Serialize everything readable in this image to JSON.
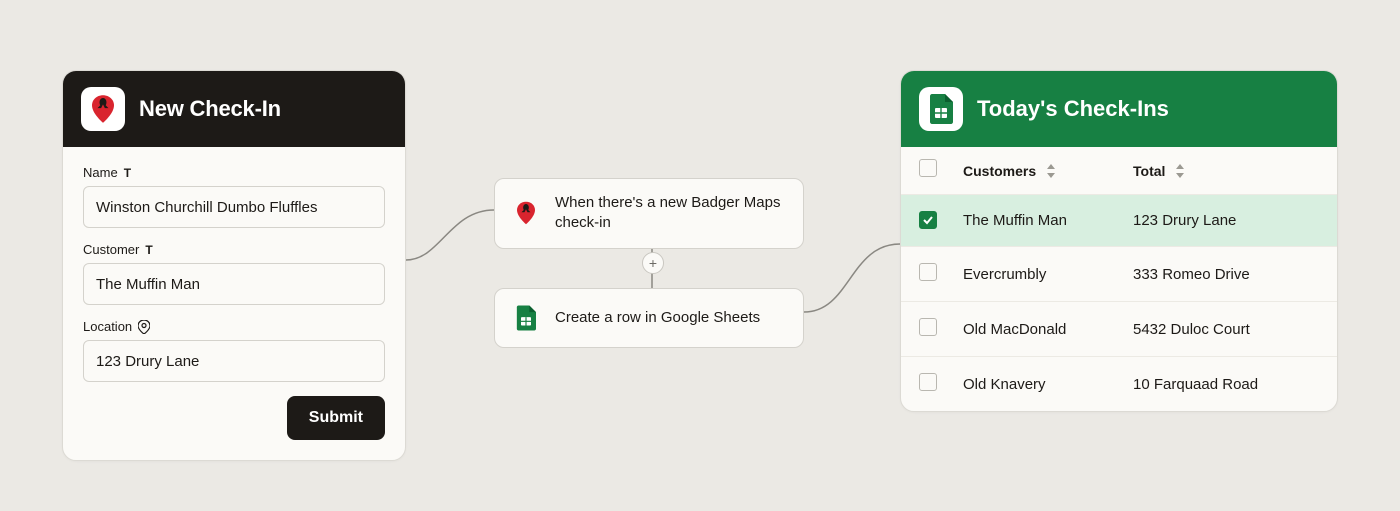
{
  "colors": {
    "brand_dark": "#1d1a17",
    "sheets_green": "#178043",
    "selected_row": "#d8efe0"
  },
  "form": {
    "title": "New Check-In",
    "fields": {
      "name": {
        "label": "Name",
        "type_glyph": "T",
        "value": "Winston Churchill Dumbo Fluffles"
      },
      "customer": {
        "label": "Customer",
        "type_glyph": "T",
        "value": "The Muffin Man"
      },
      "location": {
        "label": "Location",
        "type_glyph": "pin",
        "value": "123 Drury Lane"
      }
    },
    "submit_label": "Submit"
  },
  "steps": {
    "trigger": "When there's a new Badger Maps check-in",
    "action": "Create a row in Google Sheets",
    "add_glyph": "+"
  },
  "sheet": {
    "title": "Today's Check-Ins",
    "columns": {
      "col1": "Customers",
      "col2": "Total"
    },
    "rows": [
      {
        "checked": true,
        "customer": "The Muffin Man",
        "total": "123 Drury Lane"
      },
      {
        "checked": false,
        "customer": "Evercrumbly",
        "total": "333 Romeo Drive"
      },
      {
        "checked": false,
        "customer": "Old MacDonald",
        "total": "5432 Duloc Court"
      },
      {
        "checked": false,
        "customer": "Old Knavery",
        "total": "10 Farquaad Road"
      }
    ]
  }
}
